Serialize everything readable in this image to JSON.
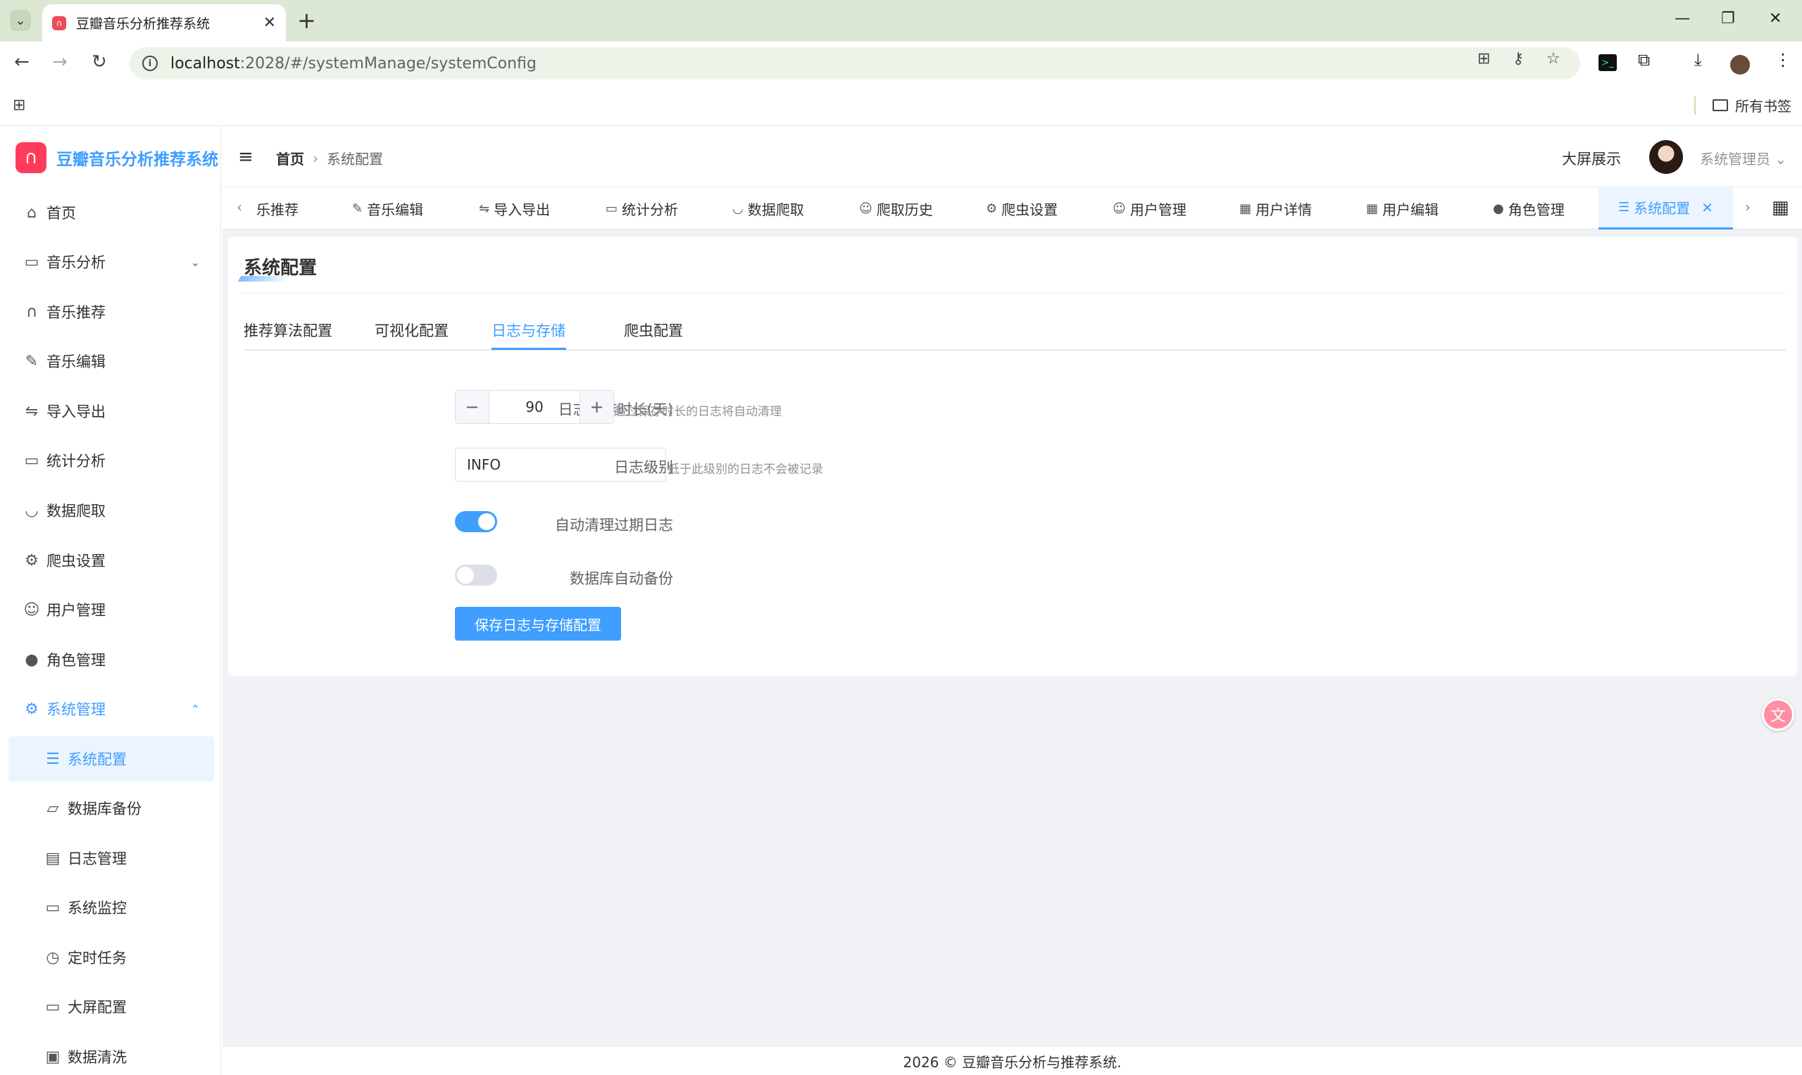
{
  "browser": {
    "tab_title": "豆瓣音乐分析推荐系统",
    "url_host": "localhost",
    "url_rest": ":2028/#/systemManage/systemConfig",
    "bookmark_folder": "所有书签"
  },
  "app": {
    "logo_text": "豆瓣音乐分析推荐系统",
    "footer": "2026 © 豆瓣音乐分析与推荐系统."
  },
  "sidebar": {
    "items": [
      {
        "label": "首页",
        "icon": "home-icon"
      },
      {
        "label": "音乐分析",
        "icon": "chart-board-icon"
      },
      {
        "label": "音乐推荐",
        "icon": "headphones-icon"
      },
      {
        "label": "音乐编辑",
        "icon": "edit-icon"
      },
      {
        "label": "导入导出",
        "icon": "transfer-icon"
      },
      {
        "label": "统计分析",
        "icon": "stats-board-icon"
      },
      {
        "label": "数据爬取",
        "icon": "bowl-icon"
      },
      {
        "label": "爬虫设置",
        "icon": "gear-icon"
      },
      {
        "label": "用户管理",
        "icon": "user-icon"
      },
      {
        "label": "角色管理",
        "icon": "user-filled-icon"
      },
      {
        "label": "系统管理",
        "icon": "setting-icon"
      }
    ],
    "sub_items": [
      {
        "label": "系统配置",
        "icon": "sliders-icon"
      },
      {
        "label": "数据库备份",
        "icon": "folder-icon"
      },
      {
        "label": "日志管理",
        "icon": "document-icon"
      },
      {
        "label": "系统监控",
        "icon": "monitor-icon"
      },
      {
        "label": "定时任务",
        "icon": "stopwatch-icon"
      },
      {
        "label": "大屏配置",
        "icon": "screen-icon"
      },
      {
        "label": "数据清洗",
        "icon": "printer-icon"
      }
    ]
  },
  "header": {
    "breadcrumb_home": "首页",
    "breadcrumb_current": "系统配置",
    "big_screen": "大屏展示",
    "user_name": "系统管理员"
  },
  "tags": [
    {
      "label": "乐推荐",
      "icon": "headphones-icon"
    },
    {
      "label": "音乐编辑",
      "icon": "edit-icon"
    },
    {
      "label": "导入导出",
      "icon": "transfer-icon"
    },
    {
      "label": "统计分析",
      "icon": "stats-board-icon"
    },
    {
      "label": "数据爬取",
      "icon": "bowl-icon"
    },
    {
      "label": "爬取历史",
      "icon": "user-icon"
    },
    {
      "label": "爬虫设置",
      "icon": "gear-icon"
    },
    {
      "label": "用户管理",
      "icon": "user-icon"
    },
    {
      "label": "用户详情",
      "icon": "grid-icon"
    },
    {
      "label": "用户编辑",
      "icon": "grid-icon"
    },
    {
      "label": "角色管理",
      "icon": "user-filled-icon"
    },
    {
      "label": "系统配置",
      "icon": "sliders-icon",
      "active": true
    }
  ],
  "card": {
    "title": "系统配置",
    "subtabs": [
      "推荐算法配置",
      "可视化配置",
      "日志与存储",
      "爬虫配置"
    ],
    "active_subtab": "日志与存储"
  },
  "form": {
    "log_retention_label": "日志保存时长(天)",
    "log_retention_value": "90",
    "log_retention_help": "超过保存时长的日志将自动清理",
    "log_level_label": "日志级别",
    "log_level_value": "INFO",
    "log_level_help": "低于此级别的日志不会被记录",
    "auto_clean_label": "自动清理过期日志",
    "auto_clean_on": true,
    "db_backup_label": "数据库自动备份",
    "db_backup_on": false,
    "save_button": "保存日志与存储配置"
  },
  "colors": {
    "primary": "#409eff",
    "logo_red": "#ff3b5c",
    "chrome_green": "#dce8d3"
  }
}
